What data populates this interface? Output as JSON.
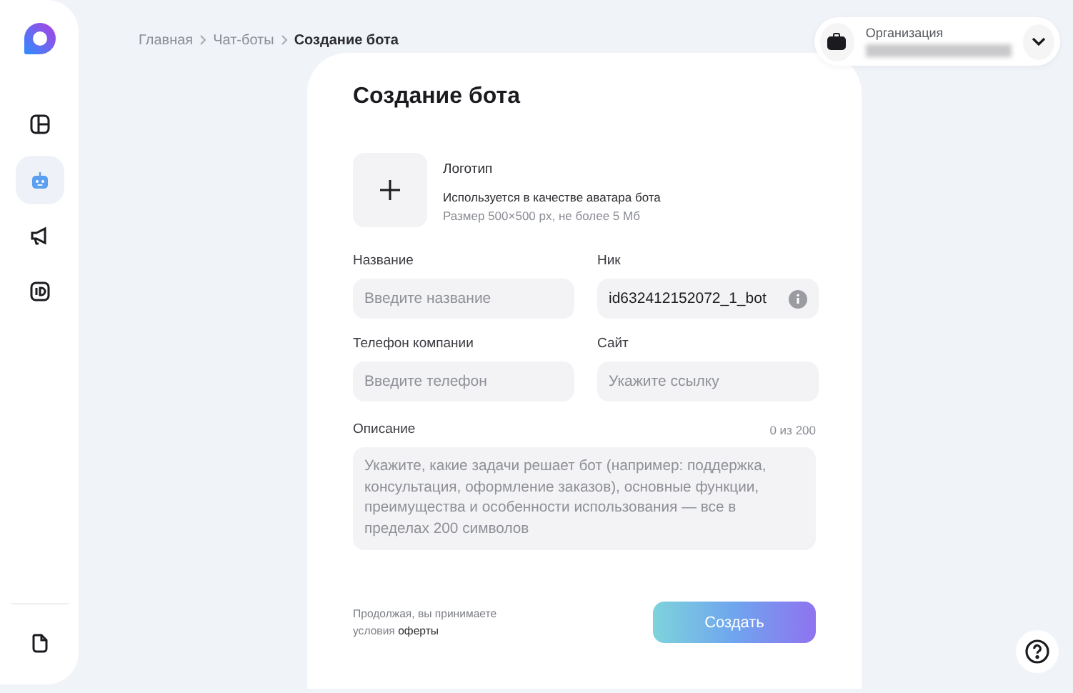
{
  "sidebar": {
    "items": [
      {
        "kind": "dashboard",
        "selected": false
      },
      {
        "kind": "bot",
        "selected": true
      },
      {
        "kind": "megaphone",
        "selected": false
      },
      {
        "kind": "id",
        "selected": false
      }
    ],
    "footer_items": [
      {
        "kind": "document",
        "selected": false
      }
    ]
  },
  "breadcrumbs": [
    {
      "label": "Главная",
      "current": false
    },
    {
      "label": "Чат-боты",
      "current": false
    },
    {
      "label": "Создание бота",
      "current": true
    }
  ],
  "organization": {
    "label": "Организация"
  },
  "form": {
    "title": "Создание бота",
    "logo": {
      "label": "Логотип",
      "hint": "Используется в качестве аватара бота",
      "size_note": "Размер 500×500 px, не более 5 Мб"
    },
    "fields": [
      {
        "label": "Название",
        "placeholder": "Введите название"
      },
      {
        "label": "Ник",
        "value": "id632412152072_1_bot",
        "info": true
      },
      {
        "label": "Телефон компании",
        "placeholder": "Введите телефон"
      },
      {
        "label": "Сайт",
        "placeholder": "Укажите ссылку"
      }
    ],
    "description": {
      "label": "Описание",
      "counter": "0 из 200",
      "placeholder": "Укажите, какие задачи решает бот (например: поддержка, консультация, оформление заказов), основные функции, преимущества и особенности использования — все в пределах 200 символов"
    },
    "terms": {
      "text": "Продолжая, вы принимаете условия",
      "link": "оферты"
    },
    "submit": "Создать"
  }
}
